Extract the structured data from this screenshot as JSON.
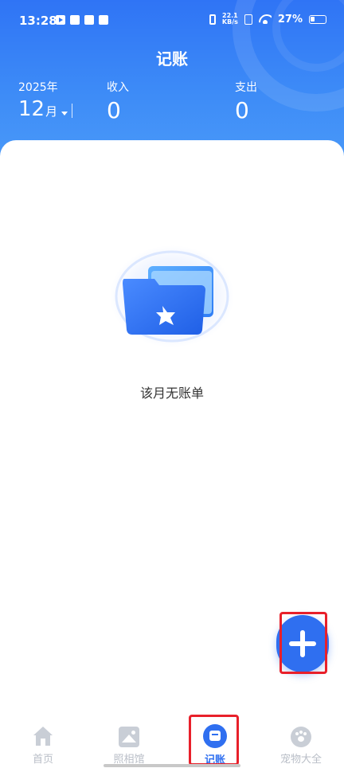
{
  "status_bar": {
    "time": "13:28",
    "speed_top": "22.1",
    "speed_bottom": "KB/s",
    "battery": "27%"
  },
  "header": {
    "title": "记账",
    "year": "2025年",
    "month_number": "12",
    "month_suffix": "月",
    "income_label": "收入",
    "income_value": "0",
    "expense_label": "支出",
    "expense_value": "0"
  },
  "empty_state": {
    "message": "该月无账单",
    "icon": "empty-folder-icon"
  },
  "fab": {
    "icon": "plus-icon"
  },
  "tabs": [
    {
      "label": "首页",
      "icon": "home-icon",
      "active": false
    },
    {
      "label": "照相馆",
      "icon": "photo-icon",
      "active": false
    },
    {
      "label": "记账",
      "icon": "ledger-icon",
      "active": true
    },
    {
      "label": "宠物大全",
      "icon": "paw-icon",
      "active": false
    }
  ],
  "colors": {
    "primary": "#2f6ff0",
    "header_gradient_top": "#2f74f5",
    "header_gradient_bottom": "#4a9af8",
    "inactive_tab": "#b9bec7",
    "highlight_outline": "#e8202a"
  }
}
